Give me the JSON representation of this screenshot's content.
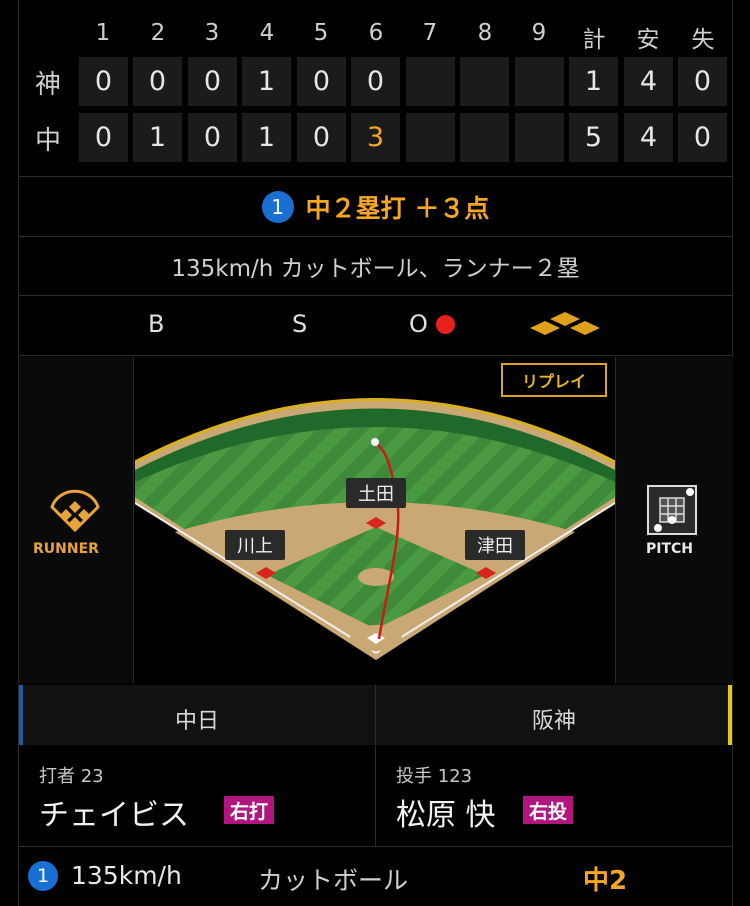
{
  "scoreboard": {
    "innings": [
      "1",
      "2",
      "3",
      "4",
      "5",
      "6",
      "7",
      "8",
      "9"
    ],
    "totals_headers": [
      "計",
      "安",
      "失"
    ],
    "teams": [
      {
        "abbr": "神",
        "runs": [
          "0",
          "0",
          "0",
          "1",
          "0",
          "0",
          "",
          "",
          ""
        ],
        "totals": [
          "1",
          "4",
          "0"
        ]
      },
      {
        "abbr": "中",
        "runs": [
          "0",
          "1",
          "0",
          "1",
          "0",
          "3",
          "",
          "",
          ""
        ],
        "totals": [
          "5",
          "4",
          "0"
        ]
      }
    ]
  },
  "play": {
    "number": "1",
    "result": "中２塁打 ＋３点",
    "description": "135km/h カットボール、ランナー２塁"
  },
  "count": {
    "b_label": "B",
    "s_label": "S",
    "o_label": "O",
    "outs": 1
  },
  "field": {
    "runner_label": "RUNNER",
    "pitch_label": "PITCH",
    "replay_label": "リプレイ",
    "fielders": {
      "cf": "土田",
      "ss": "川上",
      "b2": "津田"
    }
  },
  "teams": {
    "home": "中日",
    "away": "阪神",
    "home_color": "#1f5aa8",
    "away_color": "#e8c41c"
  },
  "batter": {
    "role": "打者 23",
    "name": "チェイビス",
    "hand": "右打"
  },
  "pitcher": {
    "role": "投手 123",
    "name": "松原 快",
    "hand": "右投"
  },
  "pitch_row": {
    "number": "1",
    "speed": "135km/h",
    "type": "カットボール",
    "result": "中2"
  },
  "colors": {
    "accent": "#f5a623",
    "badge": "#b1157e",
    "blue": "#1a6fd3",
    "red": "#e8201c"
  }
}
